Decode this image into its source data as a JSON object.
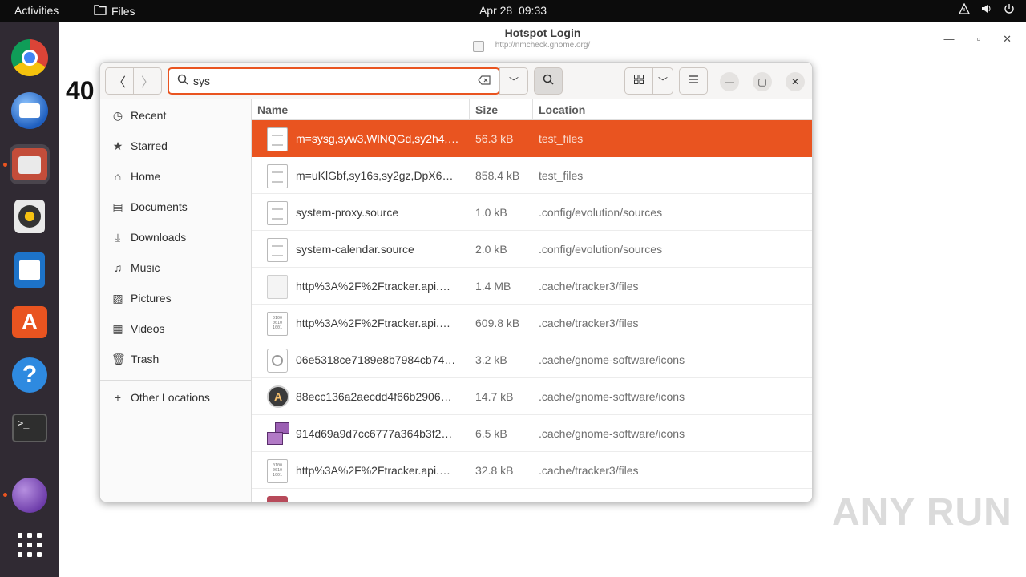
{
  "topbar": {
    "activities": "Activities",
    "app_name": "Files",
    "date": "Apr 28",
    "time": "09:33"
  },
  "dock": {
    "items": [
      "chrome",
      "thunderbird",
      "files",
      "rhythmbox",
      "libreoffice-writer",
      "app-center",
      "help",
      "terminal",
      "tor-browser",
      "show-apps"
    ],
    "active": "files"
  },
  "browser_window": {
    "title": "Hotspot Login",
    "url": "http://nmcheck.gnome.org/",
    "heading_partial": "40"
  },
  "watermark": "ANY RUN",
  "files_window": {
    "search": {
      "value": "sys",
      "placeholder": ""
    },
    "sidebar": {
      "items": [
        {
          "label": "Recent",
          "icon": "clock-icon"
        },
        {
          "label": "Starred",
          "icon": "star-icon"
        },
        {
          "label": "Home",
          "icon": "home-icon"
        },
        {
          "label": "Documents",
          "icon": "document-icon"
        },
        {
          "label": "Downloads",
          "icon": "download-icon"
        },
        {
          "label": "Music",
          "icon": "music-icon"
        },
        {
          "label": "Pictures",
          "icon": "picture-icon"
        },
        {
          "label": "Videos",
          "icon": "video-icon"
        },
        {
          "label": "Trash",
          "icon": "trash-icon"
        }
      ],
      "other_locations": "Other Locations"
    },
    "columns": {
      "name": "Name",
      "size": "Size",
      "location": "Location"
    },
    "rows": [
      {
        "name": "m=sysg,syw3,WlNQGd,sy2h4,…",
        "size": "56.3 kB",
        "location": "test_files",
        "icon": "document"
      },
      {
        "name": "m=uKlGbf,sy16s,sy2gz,DpX6…",
        "size": "858.4 kB",
        "location": "test_files",
        "icon": "document"
      },
      {
        "name": "system-proxy.source",
        "size": "1.0 kB",
        "location": ".config/evolution/sources",
        "icon": "document"
      },
      {
        "name": "system-calendar.source",
        "size": "2.0 kB",
        "location": ".config/evolution/sources",
        "icon": "document"
      },
      {
        "name": "http%3A%2F%2Ftracker.api.…",
        "size": "1.4 MB",
        "location": ".cache/tracker3/files",
        "icon": "blank"
      },
      {
        "name": "http%3A%2F%2Ftracker.api.…",
        "size": "609.8 kB",
        "location": ".cache/tracker3/files",
        "icon": "binary"
      },
      {
        "name": "06e5318ce7189e8b7984cb74…",
        "size": "3.2 kB",
        "location": ".cache/gnome-software/icons",
        "icon": "clock"
      },
      {
        "name": "88ecc136a2aecdd4f66b2906…",
        "size": "14.7 kB",
        "location": ".cache/gnome-software/icons",
        "icon": "app-store"
      },
      {
        "name": "914d69a9d7cc6777a364b3f2…",
        "size": "6.5 kB",
        "location": ".cache/gnome-software/icons",
        "icon": "screens"
      },
      {
        "name": "http%3A%2F%2Ftracker.api.…",
        "size": "32.8 kB",
        "location": ".cache/tracker3/files",
        "icon": "binary"
      }
    ],
    "selected_row": 0
  },
  "colors": {
    "accent": "#e95420",
    "dock_bg": "#302a33",
    "topbar_bg": "#0c0c0c"
  }
}
